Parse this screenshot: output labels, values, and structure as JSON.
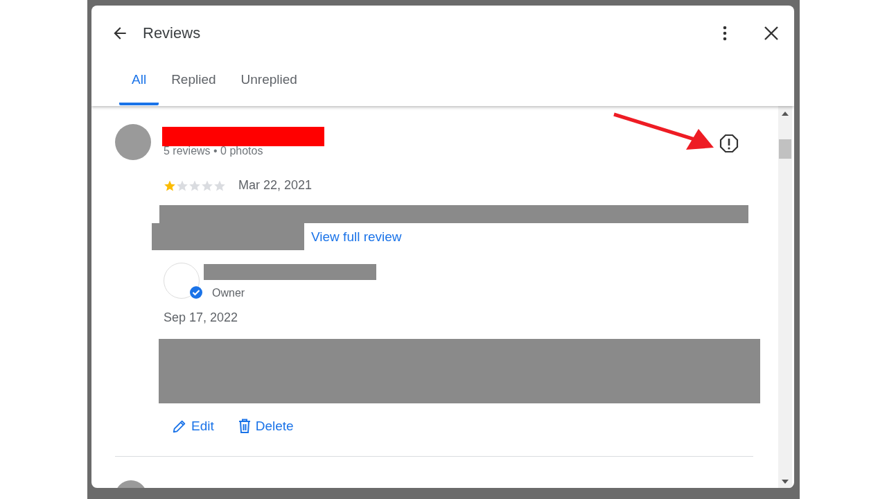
{
  "dialog": {
    "title": "Reviews",
    "tabs": [
      {
        "label": "All",
        "selected": true
      },
      {
        "label": "Replied",
        "selected": false
      },
      {
        "label": "Unreplied",
        "selected": false
      }
    ],
    "review": {
      "meta": "5 reviews • 0 photos",
      "stars": 1,
      "date": "Mar 22, 2021",
      "link": "View full review",
      "reply": {
        "role": "Owner",
        "date": "Sep 17, 2022"
      },
      "actions": [
        {
          "kind": "edit",
          "label": "Edit"
        },
        {
          "kind": "delete",
          "label": "Delete"
        }
      ]
    }
  }
}
